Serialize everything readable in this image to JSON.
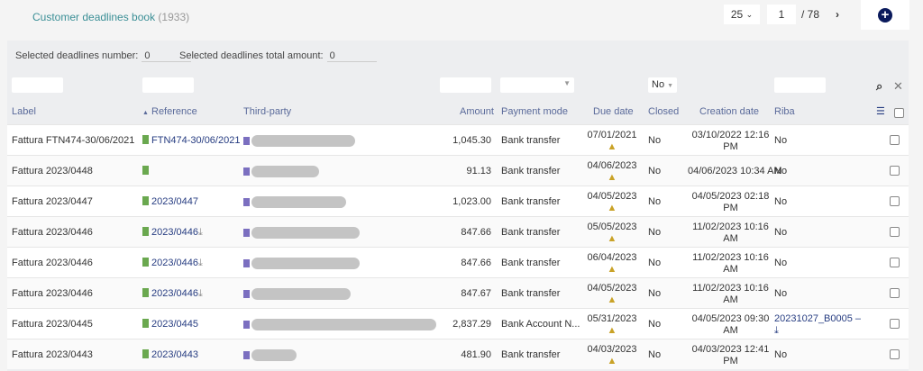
{
  "header": {
    "title": "Customer deadlines book",
    "count": "(1933)"
  },
  "pager": {
    "per_page": "25",
    "page": "1",
    "total_pages": "/ 78"
  },
  "selection": {
    "number_label": "Selected deadlines number:",
    "number_value": "0",
    "amount_label": "Selected deadlines total amount:",
    "amount_value": "0"
  },
  "filters": {
    "closed": "No"
  },
  "columns": [
    "Label",
    "Reference",
    "Third-party",
    "Amount",
    "Payment mode",
    "Due date",
    "Closed",
    "Creation date",
    "Riba"
  ],
  "rows": [
    {
      "label": "Fattura FTN474-30/06/2021",
      "ref": "FTN474-30/06/2021",
      "amount": "1,045.30",
      "mode": "Bank transfer",
      "due": "07/01/2021",
      "closed": "No",
      "created1": "03/10/2022 12:16",
      "created2": "PM",
      "riba": "No"
    },
    {
      "label": "Fattura 2023/0448",
      "ref": "",
      "amount": "91.13",
      "mode": "Bank transfer",
      "due": "04/06/2023",
      "closed": "No",
      "created1": "04/06/2023 10:34 AM",
      "created2": "",
      "riba": "No"
    },
    {
      "label": "Fattura 2023/0447",
      "ref": "2023/0447",
      "amount": "1,023.00",
      "mode": "Bank transfer",
      "due": "04/05/2023",
      "closed": "No",
      "created1": "04/05/2023 02:18",
      "created2": "PM",
      "riba": "No"
    },
    {
      "label": "Fattura 2023/0446",
      "ref": "2023/0446",
      "amount": "847.66",
      "mode": "Bank transfer",
      "due": "05/05/2023",
      "closed": "No",
      "created1": "11/02/2023 10:16",
      "created2": "AM",
      "riba": "No"
    },
    {
      "label": "Fattura 2023/0446",
      "ref": "2023/0446",
      "amount": "847.66",
      "mode": "Bank transfer",
      "due": "06/04/2023",
      "closed": "No",
      "created1": "11/02/2023 10:16",
      "created2": "AM",
      "riba": "No"
    },
    {
      "label": "Fattura 2023/0446",
      "ref": "2023/0446",
      "amount": "847.67",
      "mode": "Bank transfer",
      "due": "04/05/2023",
      "closed": "No",
      "created1": "11/02/2023 10:16",
      "created2": "AM",
      "riba": "No"
    },
    {
      "label": "Fattura 2023/0445",
      "ref": "2023/0445",
      "amount": "2,837.29",
      "mode": "Bank Account N...",
      "due": "05/31/2023",
      "closed": "No",
      "created1": "04/05/2023 09:30",
      "created2": "AM",
      "riba": "20231027_B0005 –"
    },
    {
      "label": "Fattura 2023/0443",
      "ref": "2023/0443",
      "amount": "481.90",
      "mode": "Bank transfer",
      "due": "04/03/2023",
      "closed": "No",
      "created1": "04/03/2023 12:41",
      "created2": "PM",
      "riba": "No"
    }
  ]
}
